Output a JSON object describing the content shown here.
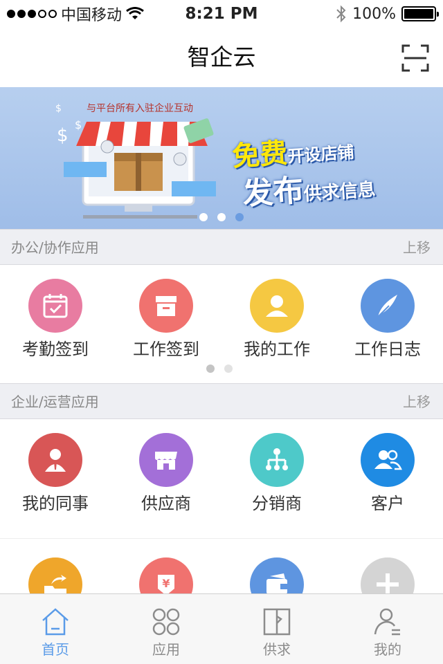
{
  "status_bar": {
    "carrier": "中国移动",
    "time": "8:21 PM",
    "battery": "100%",
    "signal_level": 3
  },
  "nav": {
    "title": "智企云",
    "scan_icon": "scan-icon"
  },
  "banner": {
    "caption": "与平台所有入驻企业互动",
    "line1_big": "免费",
    "line1_small": "开设店铺",
    "line2_big": "发布",
    "line2_small": "供求信息",
    "active_dot": 3
  },
  "sections": [
    {
      "title": "办公/协作应用",
      "action": "上移",
      "items": [
        {
          "label": "考勤签到",
          "icon": "calendar-check-icon",
          "color": "#e87ca1"
        },
        {
          "label": "工作签到",
          "icon": "archive-box-icon",
          "color": "#f0726f"
        },
        {
          "label": "我的工作",
          "icon": "person-icon",
          "color": "#f5c842"
        },
        {
          "label": "工作日志",
          "icon": "quill-pen-icon",
          "color": "#5e95e0"
        }
      ]
    },
    {
      "title": "企业/运营应用",
      "action": "上移",
      "items": [
        {
          "label": "我的同事",
          "icon": "colleague-icon",
          "color": "#d85656"
        },
        {
          "label": "供应商",
          "icon": "storefront-icon",
          "color": "#a36fd8"
        },
        {
          "label": "分销商",
          "icon": "network-icon",
          "color": "#4ec9c9"
        },
        {
          "label": "客户",
          "icon": "customers-icon",
          "color": "#1f8be3"
        }
      ],
      "items_row2": [
        {
          "icon": "folder-share-icon",
          "color": "#efa62b"
        },
        {
          "icon": "yuan-download-icon",
          "color": "#f0726f"
        },
        {
          "icon": "wallet-icon",
          "color": "#5e95e0"
        },
        {
          "icon": "plus-icon",
          "color": "#d4d4d4"
        }
      ]
    }
  ],
  "tabs": [
    {
      "label": "首页",
      "icon": "home-icon",
      "active": true
    },
    {
      "label": "应用",
      "icon": "apps-icon",
      "active": false
    },
    {
      "label": "供求",
      "icon": "supply-demand-icon",
      "active": false
    },
    {
      "label": "我的",
      "icon": "profile-icon",
      "active": false
    }
  ],
  "colors": {
    "accent": "#5a9be8",
    "banner_bg": "#a9c5ec",
    "section_bg": "#eeeff3"
  }
}
